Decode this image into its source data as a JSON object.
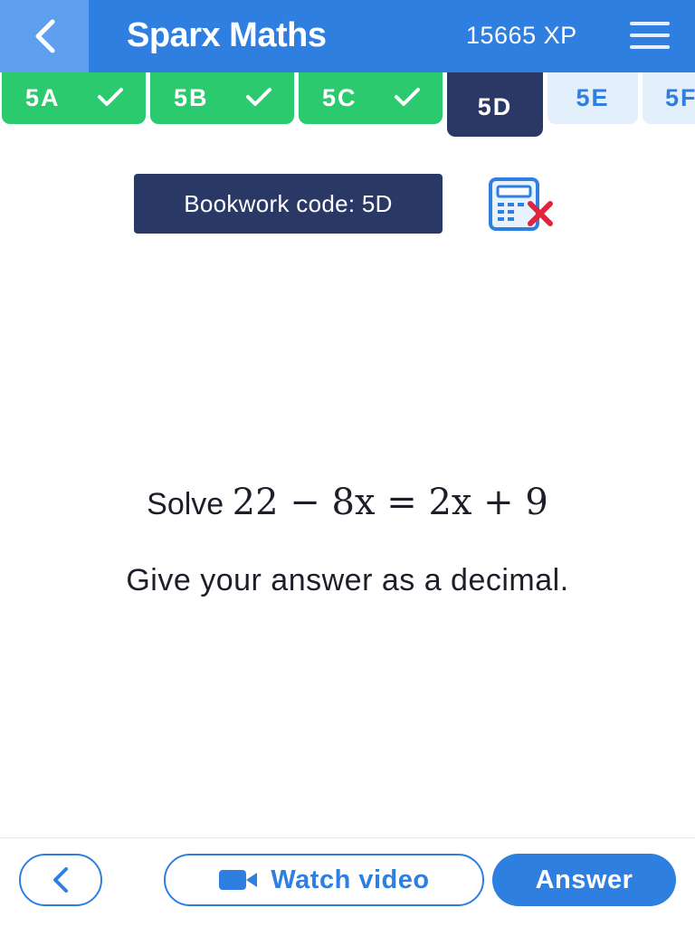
{
  "header": {
    "back_icon": "chevron-left-icon",
    "title": "Sparx Maths",
    "xp": "15665 XP",
    "menu_icon": "hamburger-menu-icon"
  },
  "tabs": [
    {
      "label": "5A",
      "status": "complete",
      "icon": "check-icon"
    },
    {
      "label": "5B",
      "status": "complete",
      "icon": "check-icon"
    },
    {
      "label": "5C",
      "status": "complete",
      "icon": "check-icon"
    },
    {
      "label": "5D",
      "status": "active"
    },
    {
      "label": "5E",
      "status": "incomplete"
    },
    {
      "label": "5F",
      "status": "incomplete"
    }
  ],
  "bookwork": {
    "label": "Bookwork code: 5D",
    "calculator_icon": "calculator-not-allowed-icon"
  },
  "question": {
    "prefix": "Solve",
    "equation": "22 − 8x = 2x + 9",
    "instruction": "Give your answer as a decimal."
  },
  "footer": {
    "back_icon": "chevron-left-icon",
    "watch_video_icon": "video-camera-icon",
    "watch_video_label": "Watch video",
    "answer_label": "Answer"
  },
  "colors": {
    "header_blue": "#2f7fe0",
    "back_button_blue": "#5fa0ee",
    "tab_complete_green": "#2bca6f",
    "tab_active_navy": "#2a3866",
    "tab_inactive_bg": "#e3effb",
    "calculator_cross_red": "#e0243b"
  }
}
